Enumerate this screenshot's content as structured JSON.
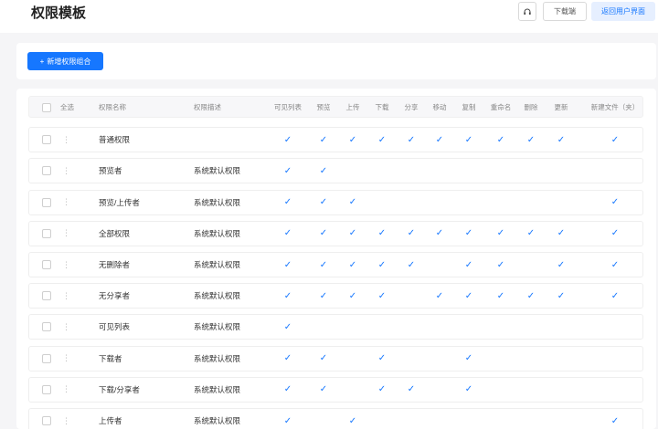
{
  "page": {
    "title": "权限模板"
  },
  "header_actions": {
    "support_icon": "headset-icon",
    "download_label": "下载端",
    "return_label": "返回用户界面"
  },
  "toolbar": {
    "add_label": "新增权限组合",
    "add_icon": "plus-icon"
  },
  "table": {
    "select_all_label": "全选",
    "name_header": "权限名称",
    "desc_header": "权限描述",
    "permission_columns": [
      "可见列表",
      "预览",
      "上传",
      "下载",
      "分享",
      "移动",
      "复制",
      "重命名",
      "删除",
      "更新",
      "新建文件（夹）"
    ],
    "check_glyph": "✓",
    "drag_glyph": "⋮",
    "rows": [
      {
        "name": "普通权限",
        "desc": "",
        "perms": [
          1,
          1,
          1,
          1,
          1,
          1,
          1,
          1,
          1,
          1,
          1
        ]
      },
      {
        "name": "预览者",
        "desc": "系统默认权限",
        "perms": [
          1,
          1,
          0,
          0,
          0,
          0,
          0,
          0,
          0,
          0,
          0
        ]
      },
      {
        "name": "预览/上传者",
        "desc": "系统默认权限",
        "perms": [
          1,
          1,
          1,
          0,
          0,
          0,
          0,
          0,
          0,
          0,
          1
        ]
      },
      {
        "name": "全部权限",
        "desc": "系统默认权限",
        "perms": [
          1,
          1,
          1,
          1,
          1,
          1,
          1,
          1,
          1,
          1,
          1
        ]
      },
      {
        "name": "无删除者",
        "desc": "系统默认权限",
        "perms": [
          1,
          1,
          1,
          1,
          1,
          0,
          1,
          1,
          0,
          1,
          1
        ]
      },
      {
        "name": "无分享者",
        "desc": "系统默认权限",
        "perms": [
          1,
          1,
          1,
          1,
          0,
          1,
          1,
          1,
          1,
          1,
          1
        ]
      },
      {
        "name": "可见列表",
        "desc": "系统默认权限",
        "perms": [
          1,
          0,
          0,
          0,
          0,
          0,
          0,
          0,
          0,
          0,
          0
        ]
      },
      {
        "name": "下载者",
        "desc": "系统默认权限",
        "perms": [
          1,
          1,
          0,
          1,
          0,
          0,
          1,
          0,
          0,
          0,
          0
        ]
      },
      {
        "name": "下载/分享者",
        "desc": "系统默认权限",
        "perms": [
          1,
          1,
          0,
          1,
          1,
          0,
          1,
          0,
          0,
          0,
          0
        ]
      },
      {
        "name": "上传者",
        "desc": "系统默认权限",
        "perms": [
          1,
          0,
          1,
          0,
          0,
          0,
          0,
          0,
          0,
          0,
          1
        ]
      }
    ]
  }
}
